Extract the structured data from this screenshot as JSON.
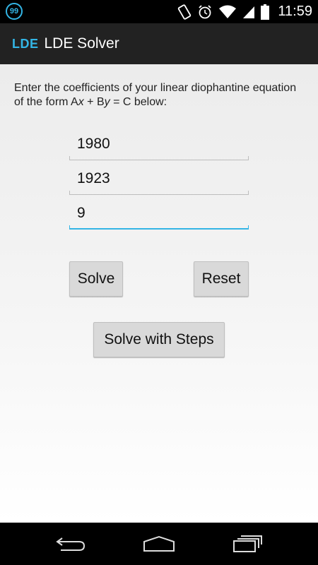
{
  "status_bar": {
    "notification_badge": "99",
    "time": "11:59"
  },
  "action_bar": {
    "logo_text": "LDE",
    "title": "LDE Solver"
  },
  "form": {
    "instructions_part1": "Enter the coefficients of your linear diophantine equation of the form A",
    "instructions_var_x": "x",
    "instructions_part2": " + B",
    "instructions_var_y": "y",
    "instructions_part3": " = C below:",
    "field_a_value": "1980",
    "field_b_value": "1923",
    "field_c_value": "9"
  },
  "buttons": {
    "solve_label": "Solve",
    "reset_label": "Reset",
    "solve_steps_label": "Solve with Steps"
  },
  "colors": {
    "accent": "#33b5e5",
    "action_bar": "#222222",
    "button": "#d9d9d9"
  }
}
